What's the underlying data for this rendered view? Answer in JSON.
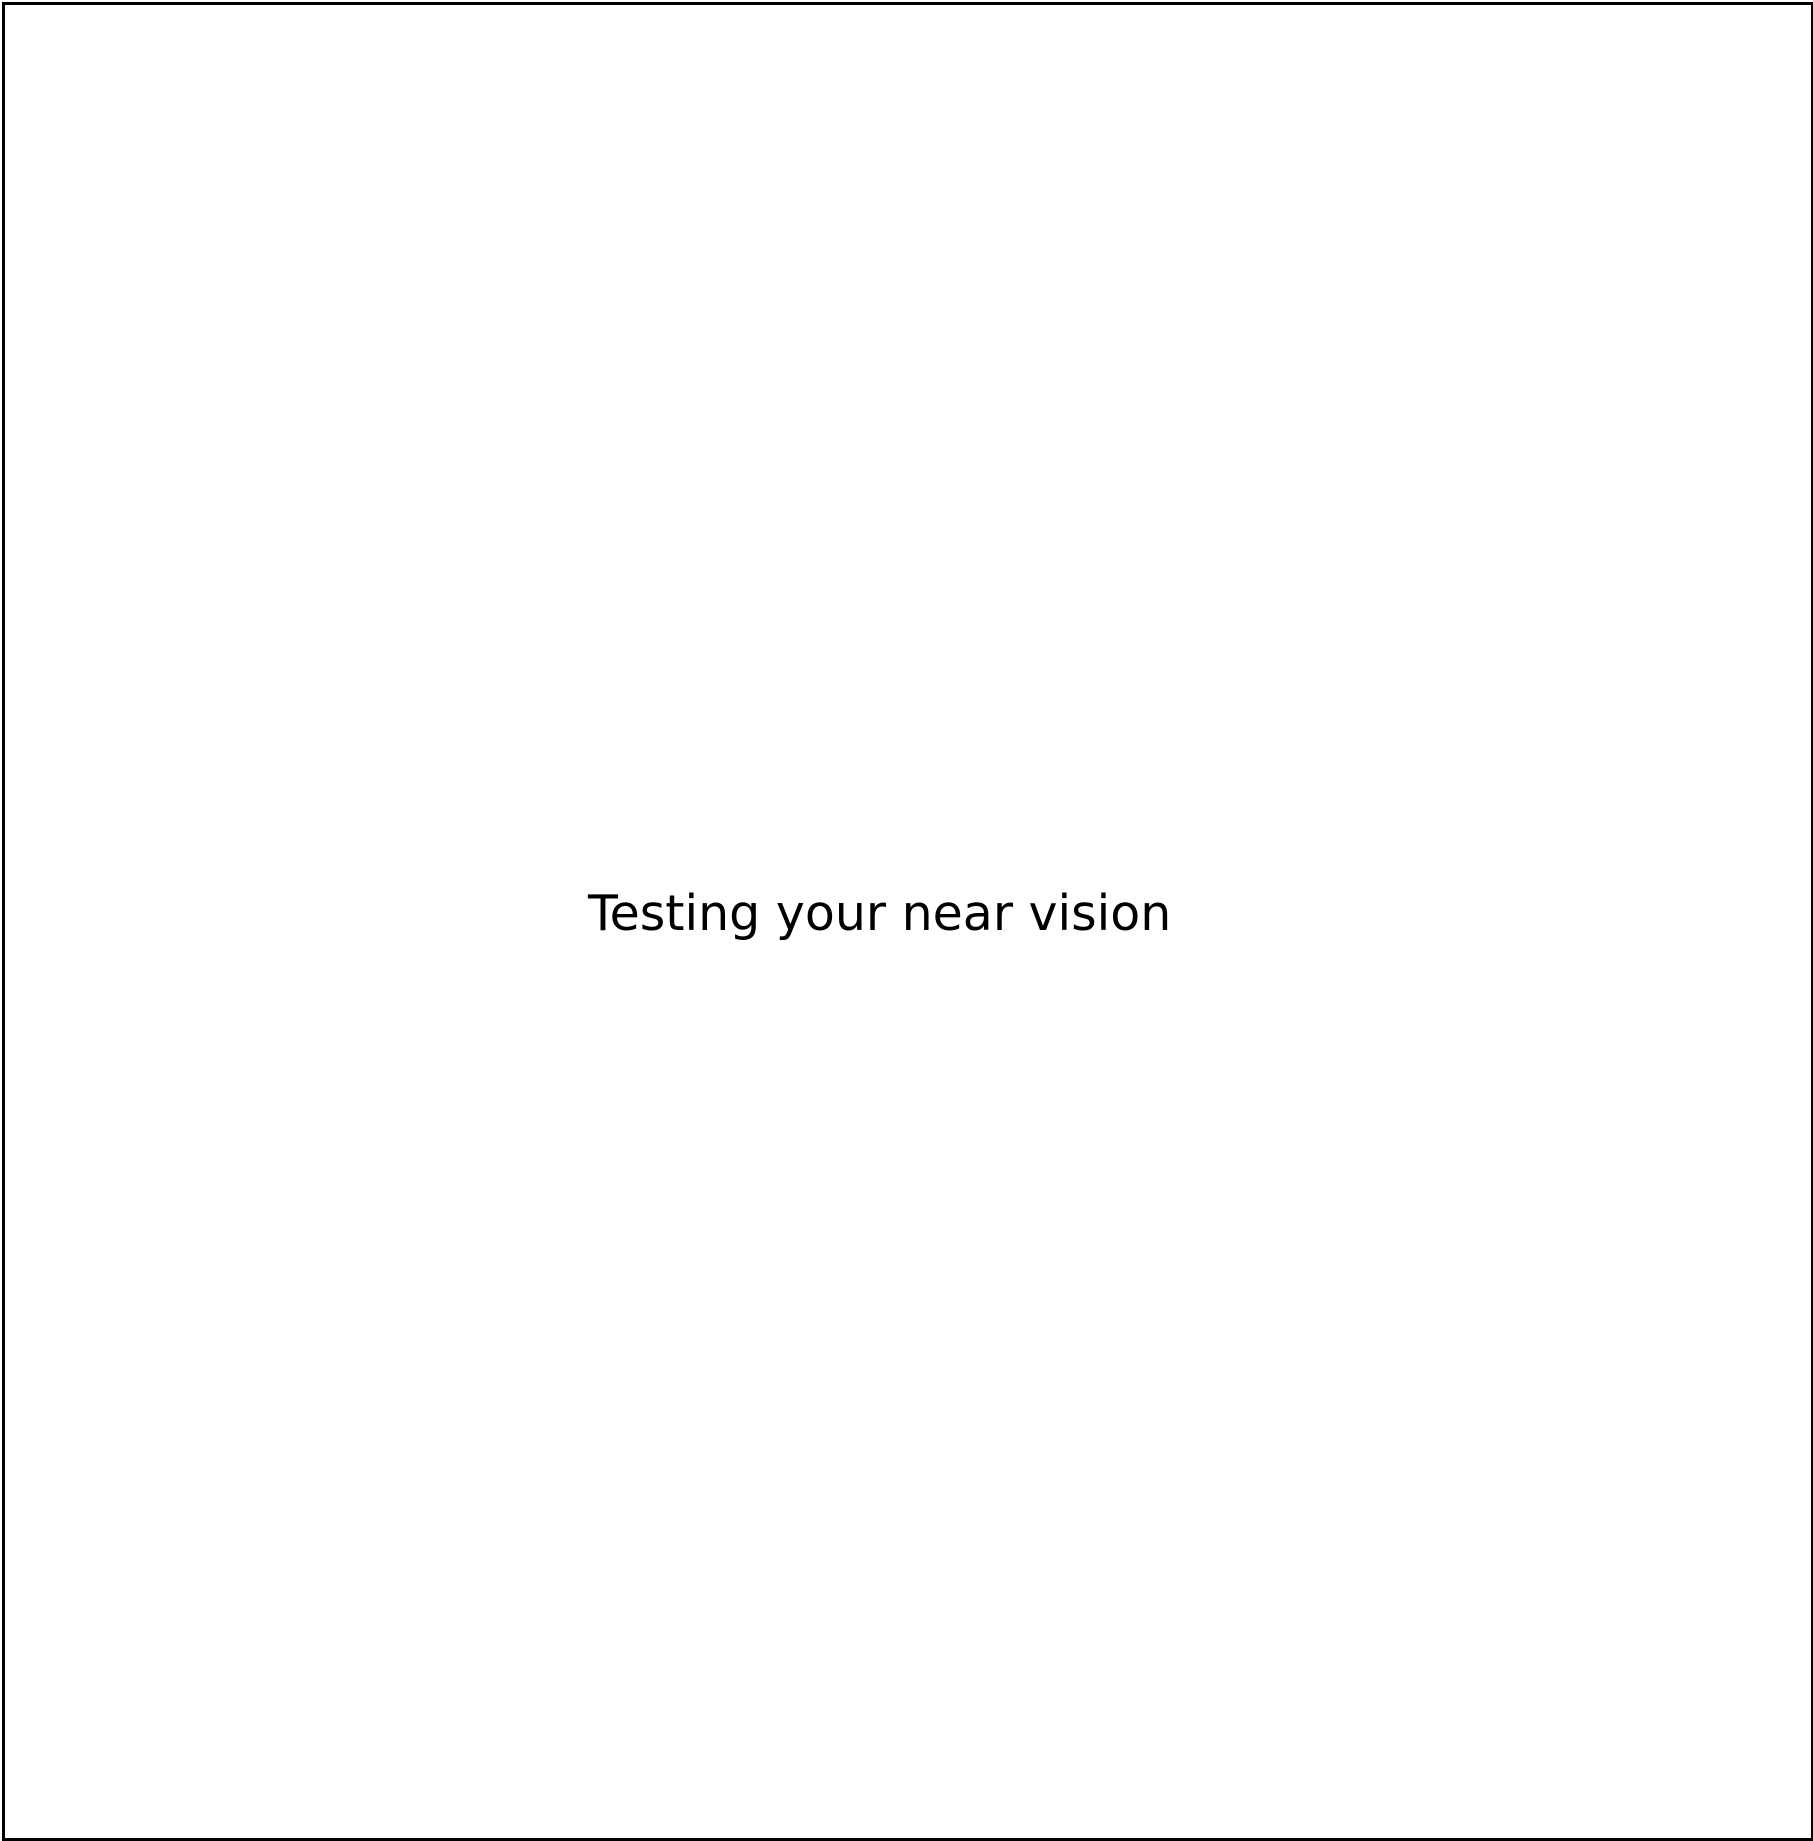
{
  "page": {
    "heading": "Testing your near vision"
  },
  "colors": {
    "border": "#000000",
    "background": "#ffffff",
    "text": "#000000"
  }
}
